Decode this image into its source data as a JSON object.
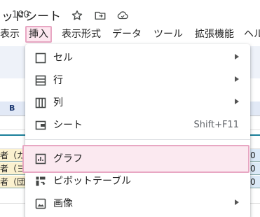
{
  "title_bar": {
    "doc_title": "ッドシート",
    "icons": [
      "star-icon",
      "move-to-folder-icon",
      "cloud-status-icon"
    ]
  },
  "menubar": {
    "items": [
      "表示",
      "挿入",
      "表示形式",
      "データ",
      "ツール",
      "拡張機能",
      "ヘル"
    ],
    "active": "挿入"
  },
  "toolbar": {
    "zoom": "100"
  },
  "sheet": {
    "column_header": "B",
    "cells_left": [
      "者（ガ",
      "者（ヨ",
      "者（団"
    ],
    "cells_right": [
      "0",
      "0",
      "0"
    ]
  },
  "insert_menu": {
    "items": [
      {
        "label": "セル",
        "icon": "cell-icon",
        "submenu": true
      },
      {
        "label": "行",
        "icon": "row-icon",
        "submenu": true
      },
      {
        "label": "列",
        "icon": "column-icon",
        "submenu": true
      },
      {
        "label": "シート",
        "icon": "sheet-icon",
        "shortcut": "Shift+F11"
      },
      {
        "label": "グラフ",
        "icon": "chart-icon",
        "highlighted": true
      },
      {
        "label": "ピボットテーブル",
        "icon": "pivot-table-icon"
      },
      {
        "label": "画像",
        "icon": "image-icon",
        "submenu": true
      }
    ]
  },
  "colors": {
    "highlight_border": "#e8a7c3",
    "highlight_fill": "#fbe9f0",
    "toolbar_bg": "#eef2f9",
    "header_bg": "#e2e9f6"
  }
}
